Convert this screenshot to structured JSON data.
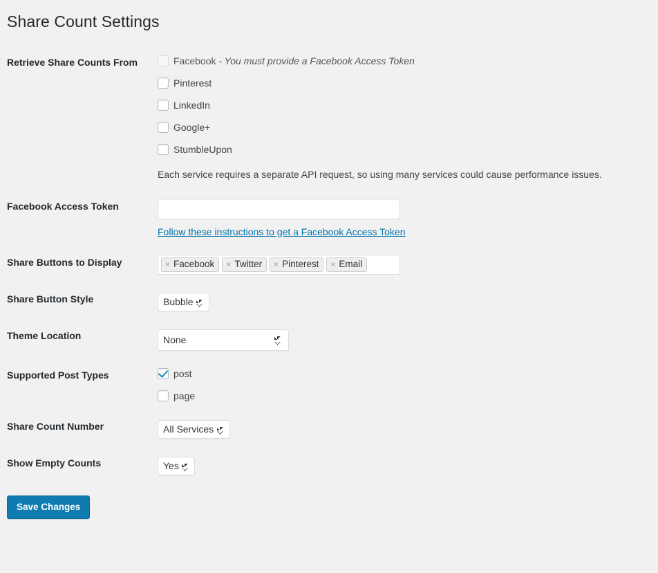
{
  "page": {
    "title": "Share Count Settings"
  },
  "rows": {
    "retrieve": {
      "label": "Retrieve Share Counts From",
      "services": [
        {
          "name": "Facebook",
          "checked": false,
          "disabled": true,
          "note": "- You must provide a Facebook Access Token"
        },
        {
          "name": "Pinterest",
          "checked": false,
          "disabled": false,
          "note": ""
        },
        {
          "name": "LinkedIn",
          "checked": false,
          "disabled": false,
          "note": ""
        },
        {
          "name": "Google+",
          "checked": false,
          "disabled": false,
          "note": ""
        },
        {
          "name": "StumbleUpon",
          "checked": false,
          "disabled": false,
          "note": ""
        }
      ],
      "description": "Each service requires a separate API request, so using many services could cause performance issues."
    },
    "access_token": {
      "label": "Facebook Access Token",
      "value": "",
      "placeholder": "",
      "link_text": "Follow these instructions to get a Facebook Access Token"
    },
    "share_buttons": {
      "label": "Share Buttons to Display",
      "tokens": [
        "Facebook",
        "Twitter",
        "Pinterest",
        "Email"
      ],
      "remove_icon": "×"
    },
    "button_style": {
      "label": "Share Button Style",
      "selected": "Bubble",
      "options": [
        "Bubble"
      ]
    },
    "theme_location": {
      "label": "Theme Location",
      "selected": "None",
      "options": [
        "None"
      ]
    },
    "post_types": {
      "label": "Supported Post Types",
      "items": [
        {
          "name": "post",
          "checked": true
        },
        {
          "name": "page",
          "checked": false
        }
      ]
    },
    "count_number": {
      "label": "Share Count Number",
      "selected": "All Services",
      "options": [
        "All Services"
      ]
    },
    "empty_counts": {
      "label": "Show Empty Counts",
      "selected": "Yes",
      "options": [
        "Yes"
      ]
    }
  },
  "submit": {
    "save_label": "Save Changes"
  },
  "colors": {
    "page_background": "#f1f1f1",
    "label_text": "#23282d",
    "link": "#0073aa",
    "primary_button": "#0e7cb0",
    "checkbox_accent": "#1e8cbe"
  }
}
